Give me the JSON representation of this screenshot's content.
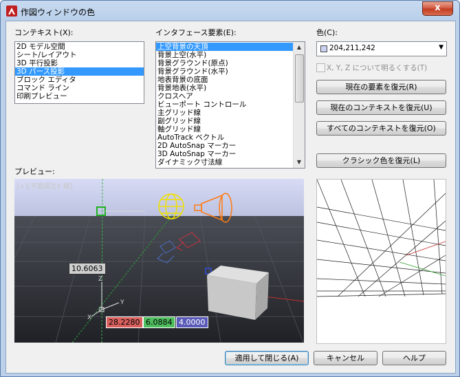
{
  "window": {
    "title": "作図ウィンドウの色",
    "close_glyph": "x"
  },
  "context": {
    "label": "コンテキスト(X):",
    "items": [
      "2D モデル空間",
      "シート/レイアウト",
      "3D 平行投影",
      "3D パース投影",
      "ブロック エディタ",
      "コマンド ライン",
      "印刷プレビュー"
    ],
    "selected_index": 3
  },
  "interface": {
    "label": "インタフェース要素(E):",
    "items": [
      "上空背景の天頂",
      "背景上空(水平)",
      "背景グラウンド(原点)",
      "背景グラウンド(水平)",
      "地表背景の底面",
      "背景地表(水平)",
      "クロスヘア",
      "ビューポート コントロール",
      "主グリッド線",
      "副グリッド線",
      "軸グリッド線",
      "AutoTrack ベクトル",
      "2D AutoSnap マーカー",
      "3D AutoSnap マーカー",
      "ダイナミック寸法線"
    ],
    "selected_index": 0
  },
  "color": {
    "label": "色(C):",
    "value": "204,211,242",
    "swatch_hex": "#ccd3f2"
  },
  "tint_checkbox": {
    "label": "X, Y, Z について明るくする(T)",
    "checked": false
  },
  "buttons": {
    "restore_element": "現在の要素を復元(R)",
    "restore_context": "現在のコンテキストを復元(U)",
    "restore_all": "すべてのコンテキストを復元(O)",
    "restore_classic": "クラシック色を復元(L)",
    "apply_close": "適用して閉じる(A)",
    "cancel": "キャンセル",
    "help": "ヘルプ"
  },
  "preview": {
    "label": "プレビュー:",
    "viewport_label": "[+][平面図][X 線]",
    "dim_value": "10.6063",
    "coord_x": "28.2280",
    "coord_y": "6.0884",
    "coord_z": "4.0000",
    "axis_z": "Z",
    "axis_y": "Y",
    "axis_x": "X"
  },
  "colors": {
    "accent": "#3399ff",
    "coord_x_bg": "#d8615e",
    "coord_y_bg": "#4fbd5e",
    "coord_z_bg": "#5a5ab8"
  },
  "icons": {
    "app": "autocad-logo-icon",
    "close": "close-icon",
    "dropdown": "chevron-down-icon"
  }
}
